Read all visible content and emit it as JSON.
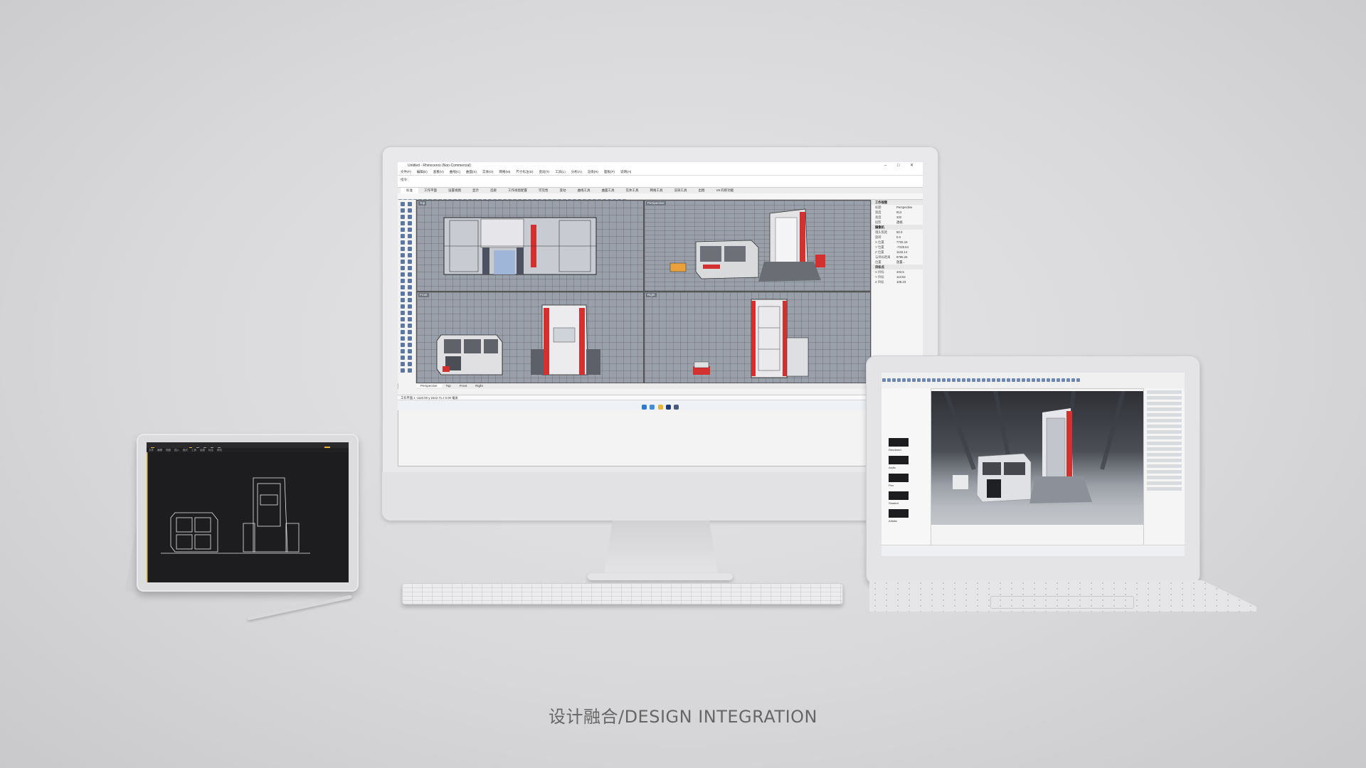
{
  "caption": "设计融合/DESIGN INTEGRATION",
  "monitor_app": {
    "title": "Untitled - Rhinoceros (Non-Commercial)",
    "menus": [
      "文件(F)",
      "编辑(E)",
      "查看(V)",
      "曲线(C)",
      "曲面(S)",
      "实体(O)",
      "网格(M)",
      "尺寸标注(D)",
      "变动(T)",
      "工具(L)",
      "分析(A)",
      "渲染(R)",
      "面板(P)",
      "说明(H)"
    ],
    "command_line": "指令:",
    "tabs": [
      "标准",
      "工作平面",
      "设置视图",
      "显示",
      "选取",
      "工作视窗配置",
      "可见性",
      "变动",
      "曲线工具",
      "曲面工具",
      "实体工具",
      "网格工具",
      "渲染工具",
      "出图",
      "V8 的新功能"
    ],
    "viewports": [
      {
        "label": "Top"
      },
      {
        "label": "Perspective"
      },
      {
        "label": "Front"
      },
      {
        "label": "Right"
      }
    ],
    "bottom_tabs": [
      "Perspective",
      "Top",
      "Front",
      "Right"
    ],
    "properties": {
      "section1": "工作视窗",
      "rows1": [
        [
          "标题",
          "Perspective"
        ],
        [
          "宽度",
          "813"
        ],
        [
          "高度",
          "332"
        ],
        [
          "投影",
          "透视"
        ]
      ],
      "section2": "摄像机",
      "rows2": [
        [
          "镜头焦距",
          "50.0"
        ],
        [
          "旋转",
          "0.0"
        ],
        [
          "X 位置",
          "7725.16"
        ],
        [
          "Y 位置",
          "-7228.54"
        ],
        [
          "Z 位置",
          "1132.14"
        ],
        [
          "与目标距离",
          "9795.26"
        ],
        [
          "位置",
          "放置..."
        ]
      ],
      "section3": "目标点",
      "rows3": [
        [
          "X 目标",
          "333.5"
        ],
        [
          "Y 目标",
          "113.62"
        ],
        [
          "Z 目标",
          "108.23"
        ]
      ]
    },
    "status": "工作平面   x -1110.00   y 1512.71   z 0.00   毫米"
  },
  "tablet_app": {
    "menus": [
      "文件",
      "编辑",
      "视图",
      "插入",
      "格式",
      "工具",
      "绘图",
      "标注",
      "修改"
    ]
  },
  "laptop_app": {
    "panel_items": [
      "Rendered",
      "Arctic",
      "Pen",
      "Shaded",
      "Artistic"
    ]
  },
  "colors": {
    "accent_red": "#d2312f",
    "viewport_gray": "#9aa0a9",
    "cad_dark": "#1d1d1f"
  }
}
